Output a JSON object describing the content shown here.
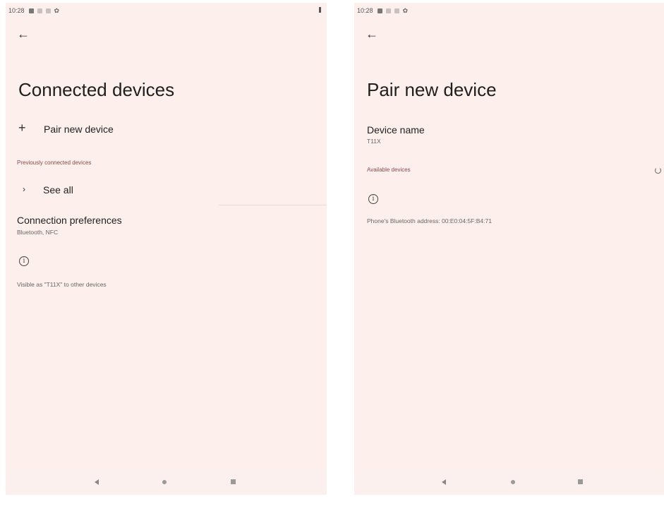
{
  "left": {
    "status_time": "10:28",
    "title": "Connected devices",
    "pair_label": "Pair new device",
    "section_header": "Previously connected devices",
    "see_all": "See all",
    "prefs_title": "Connection preferences",
    "prefs_sub": "Bluetooth, NFC",
    "visible_text": "Visible as \"T11X\" to other devices"
  },
  "right": {
    "status_time": "10:28",
    "title": "Pair new device",
    "device_name_title": "Device name",
    "device_name_value": "T11X",
    "section_header": "Available devices",
    "bt_address": "Phone's Bluetooth address: 00:E0:04:5F:B4:71"
  },
  "icons": {
    "back": "arrow-left",
    "plus": "plus",
    "chevron": "chevron-right",
    "info": "info-circle",
    "gear": "gear",
    "spinner": "loading-spinner"
  },
  "colors": {
    "background": "#fcefec",
    "section_header": "#8a4a4a",
    "text_primary": "#1f1f1f",
    "text_secondary": "#6b6565"
  }
}
